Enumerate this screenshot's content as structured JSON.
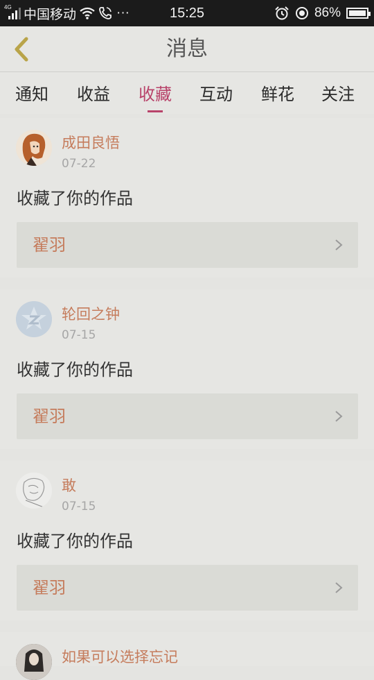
{
  "status_bar": {
    "network_type": "4G",
    "carrier": "中国移动",
    "more": "···",
    "time": "15:25",
    "battery_percent": "86%",
    "battery_level": 0.86
  },
  "header": {
    "title": "消息"
  },
  "tabs": [
    {
      "label": "通知",
      "active": false
    },
    {
      "label": "收益",
      "active": false
    },
    {
      "label": "收藏",
      "active": true
    },
    {
      "label": "互动",
      "active": false
    },
    {
      "label": "鲜花",
      "active": false
    },
    {
      "label": "关注",
      "active": false
    }
  ],
  "messages": [
    {
      "user": "成田良悟",
      "date": "07-22",
      "action": "收藏了你的作品",
      "work": "翟羽",
      "avatar": "avatar-illustration"
    },
    {
      "user": "轮回之钟",
      "date": "07-15",
      "action": "收藏了你的作品",
      "work": "翟羽",
      "avatar": "avatar-default-logo"
    },
    {
      "user": "敢",
      "date": "07-15",
      "action": "收藏了你的作品",
      "work": "翟羽",
      "avatar": "avatar-sketch"
    },
    {
      "user": "如果可以选择忘记",
      "avatar": "avatar-photo"
    }
  ],
  "colors": {
    "accent": "#b8436a",
    "name_color": "#c57c5c",
    "back_arrow": "#b9a449"
  }
}
